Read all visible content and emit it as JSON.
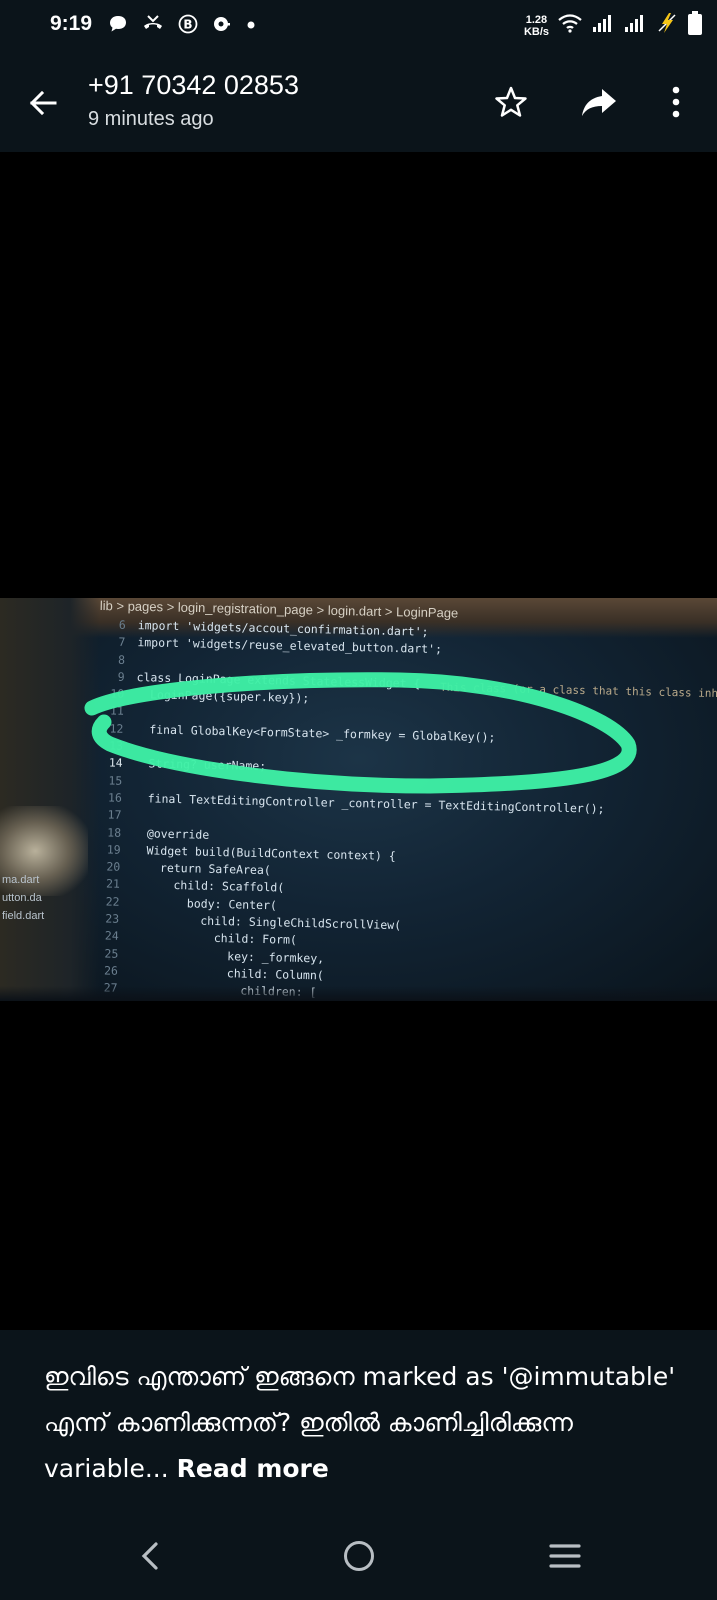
{
  "status_bar": {
    "time": "9:19",
    "net_speed_value": "1.28",
    "net_speed_unit": "KB/s",
    "left_icons": [
      "chat-bubble-icon",
      "missed-call-icon",
      "b-circle-icon",
      "vpn-key-icon",
      "dot-icon"
    ],
    "right_icons": [
      "wifi-icon",
      "signal-icon",
      "signal-icon",
      "charging-bolt-icon",
      "battery-icon"
    ]
  },
  "header": {
    "contact": "+91 70342 02853",
    "timestamp": "9 minutes ago",
    "icons": [
      "arrow-left-icon",
      "star-outline-icon",
      "forward-arrow-icon",
      "more-vert-icon"
    ]
  },
  "photo": {
    "breadcrumb": "lib > pages > login_registration_page > login.dart > LoginPage",
    "side_files": [
      "ma.dart",
      "utton.da",
      "field.dart"
    ],
    "hint": "This class (or a class that this class inhe",
    "marker_color": "#3ef0a6",
    "code_lines": [
      {
        "n": "6",
        "text": "import 'widgets/accout_confirmation.dart';"
      },
      {
        "n": "7",
        "text": "import 'widgets/reuse_elevated_button.dart';"
      },
      {
        "n": "8",
        "text": ""
      },
      {
        "n": "9",
        "text": "class LoginPage extends StatelessWidget {"
      },
      {
        "n": "10",
        "text": "  LoginPage({super.key});"
      },
      {
        "n": "11",
        "text": ""
      },
      {
        "n": "12",
        "text": "  final GlobalKey<FormState> _formkey = GlobalKey();"
      },
      {
        "n": "13",
        "text": ""
      },
      {
        "n": "14",
        "text": "  String? userName;"
      },
      {
        "n": "15",
        "text": ""
      },
      {
        "n": "16",
        "text": "  final TextEditingController _controller = TextEditingController();"
      },
      {
        "n": "17",
        "text": ""
      },
      {
        "n": "18",
        "text": "  @override"
      },
      {
        "n": "19",
        "text": "  Widget build(BuildContext context) {"
      },
      {
        "n": "20",
        "text": "    return SafeArea("
      },
      {
        "n": "21",
        "text": "      child: Scaffold("
      },
      {
        "n": "22",
        "text": "        body: Center("
      },
      {
        "n": "23",
        "text": "          child: SingleChildScrollView("
      },
      {
        "n": "24",
        "text": "            child: Form("
      },
      {
        "n": "25",
        "text": "              key: _formkey,"
      },
      {
        "n": "26",
        "text": "              child: Column("
      },
      {
        "n": "27",
        "text": "                children: ["
      }
    ]
  },
  "caption": {
    "text": "ഇവിടെ എന്താണ് ഇങ്ങനെ marked as '@immutable' എന്ന് കാണിക്കുന്നത്?  ഇതിൽ കാണിച്ചിരിക്കുന്ന variable...",
    "read_more": "Read more"
  },
  "nav_bar": {
    "icons": [
      "nav-back-icon",
      "nav-home-icon",
      "nav-recents-icon"
    ]
  }
}
